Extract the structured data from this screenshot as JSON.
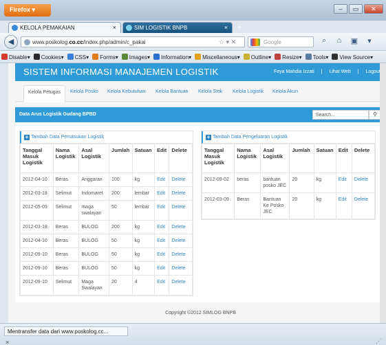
{
  "browser": {
    "menu_button": "Firefox",
    "tabs": [
      {
        "title": "KELOLA PEMAKAIAN",
        "close": "×"
      },
      {
        "title": "SIM LOGISTIK BNPB",
        "close": "×"
      }
    ],
    "new_tab": "+",
    "url_prefix": "www.poskolog.",
    "url_domain": "co.cc",
    "url_path": "/index.php/admin/c_pakai",
    "search_placeholder": "Google",
    "toolbar": [
      "Disable",
      "Cookies",
      "CSS",
      "Forms",
      "Images",
      "Information",
      "Miscellaneous",
      "Outline",
      "Resize",
      "Tools",
      "View Source"
    ],
    "toolbar_colors": [
      "#d23b2c",
      "#2a2a2a",
      "#3b7dd8",
      "#e07b1a",
      "#5a8a3a",
      "#2a6fd0",
      "#e0a020",
      "#c8b030",
      "#c04040",
      "#5a7aa0",
      "#303030"
    ],
    "status": "Mentransfer data dari www.poskolog.cc...",
    "status_close": "×"
  },
  "app": {
    "title": "SISTEM INFORMASI MANAJEMEN LOGISTIK",
    "user": "Feya Mahdia Izzati",
    "link_web": "Lihat Web",
    "logout": "Logout",
    "separator": "|",
    "nav_tabs": [
      "Kelola Petugas",
      "Kelola Posko",
      "Kelola Kebutuhan",
      "Kelola Bantuan",
      "Kelola Stok",
      "Kelola Logistik",
      "Kelola Akun"
    ],
    "panel_title": "Data Arus Logistik Gudang BPBD",
    "search_value": "Search...",
    "search_icon": "magnifier-icon",
    "footer": "Copyright ©2012 SIMLOG BNPB"
  },
  "left_table": {
    "heading": "Tambah Data Pemasukan Logistik",
    "headers": [
      "Tanggal Masuk Logistik",
      "Nama Logistik",
      "Asal Logistik",
      "Jumlah",
      "Satuan",
      "Edit",
      "Delete"
    ],
    "rows": [
      [
        "2012-04-10",
        "Beras",
        "Anggaran",
        "100",
        "kg",
        "Edit",
        "Delete"
      ],
      [
        "2012-03-18",
        "Selimut",
        "Indomaret",
        "200",
        "lembar",
        "Edit",
        "Delete"
      ],
      [
        "2012-05-09",
        "Selimut",
        "maga swalayan",
        "50",
        "lembar",
        "Edit",
        "Delete"
      ],
      [
        "2012-03-18",
        "Beras",
        "BULOG",
        "200",
        "kg",
        "Edit",
        "Delete"
      ],
      [
        "2012-04-10",
        "Beras",
        "BULOG",
        "50",
        "kg",
        "Edit",
        "Delete"
      ],
      [
        "2012-09-10",
        "Beras",
        "BULOG",
        "50",
        "kg",
        "Edit",
        "Delete"
      ],
      [
        "2012-09-10",
        "Beras",
        "BULOG",
        "50",
        "kg",
        "Edit",
        "Delete"
      ],
      [
        "2012-09-10",
        "Selimut",
        "Maga Swalayan",
        "20",
        "4",
        "Edit",
        "Delete"
      ]
    ]
  },
  "right_table": {
    "heading": "Tambah Data Pengeluaran Logistik",
    "headers": [
      "Tanggal Masuk Logistik",
      "Nama Logistik",
      "Asal Logistik",
      "Jumlah",
      "Satuan",
      "Edit",
      "Delete"
    ],
    "rows": [
      [
        "2012-09-02",
        "beras",
        "bantuan posko JEC",
        "20",
        "kg",
        "Edit",
        "Delete"
      ],
      [
        "2012-03-09",
        "Beras",
        "Bantuan Ke Posko JEC",
        "20",
        "kg",
        "Edit",
        "Delete"
      ]
    ]
  }
}
